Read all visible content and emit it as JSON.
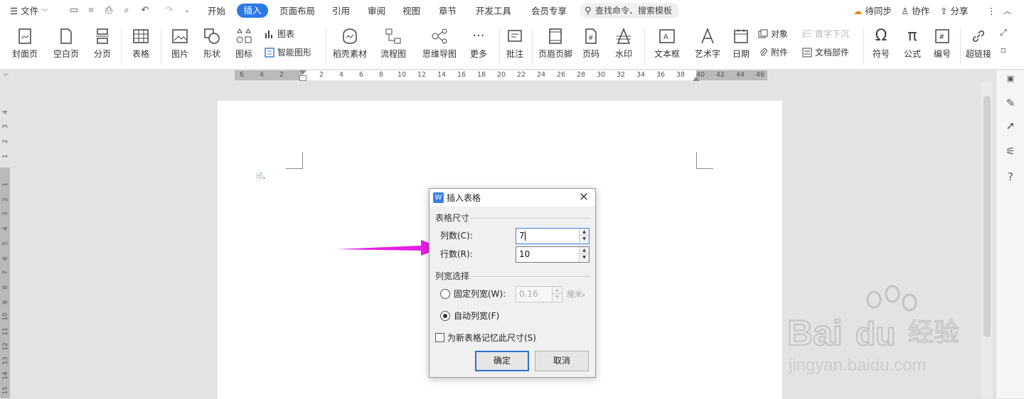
{
  "menubar": {
    "file": "文件",
    "tabs": [
      "开始",
      "插入",
      "页面布局",
      "引用",
      "审阅",
      "视图",
      "章节",
      "开发工具",
      "会员专享"
    ],
    "active_tab": "插入",
    "search_placeholder": "查找命令、搜索模板",
    "sync": "待同步",
    "collab": "协作",
    "share": "分享"
  },
  "ribbon": {
    "cover": "封面页",
    "blank": "空白页",
    "pagebreak": "分页",
    "table": "表格",
    "picture": "图片",
    "shape": "形状",
    "icon": "图标",
    "chart": "图表",
    "smartart": "智能图形",
    "material": "稻壳素材",
    "flowchart": "流程图",
    "mindmap": "思维导图",
    "more": "更多",
    "comment": "批注",
    "headerfooter": "页眉页脚",
    "pagenum": "页码",
    "watermark": "水印",
    "textbox": "文本框",
    "wordart": "艺术字",
    "date": "日期",
    "object": "对象",
    "attachment": "附件",
    "dropcap": "首字下沉",
    "docpart": "文档部件",
    "symbol": "符号",
    "formula": "公式",
    "numbering": "编号",
    "hyperlink": "超链接"
  },
  "ruler": {
    "h": [
      "6",
      "4",
      "2",
      "2",
      "4",
      "6",
      "8",
      "10",
      "12",
      "14",
      "16",
      "18",
      "20",
      "22",
      "24",
      "26",
      "28",
      "30",
      "32",
      "34",
      "36",
      "38",
      "40",
      "42",
      "44",
      "46"
    ],
    "v_top": [
      "4",
      "3",
      "2",
      "1"
    ],
    "v": [
      "1",
      "2",
      "3",
      "4",
      "5",
      "6",
      "7",
      "8",
      "9",
      "10",
      "11",
      "12",
      "13",
      "14",
      "15"
    ]
  },
  "dialog": {
    "title": "插入表格",
    "group_size": "表格尺寸",
    "cols_label": "列数(C):",
    "cols_value": "7",
    "rows_label": "行数(R):",
    "rows_value": "10",
    "group_width": "列宽选择",
    "fixed_label": "固定列宽(W):",
    "fixed_value": "0.16",
    "fixed_unit": "厘米",
    "auto_label": "自动列宽(F)",
    "remember_label": "为新表格记忆此尺寸(S)",
    "ok": "确定",
    "cancel": "取消"
  },
  "watermark_text": {
    "brand": "Bai",
    "brand2": "du",
    "cn": "经验",
    "url": "jingyan.baidu.com"
  },
  "colors": {
    "accent": "#2b79e6",
    "arrow": "#e61ee6"
  }
}
